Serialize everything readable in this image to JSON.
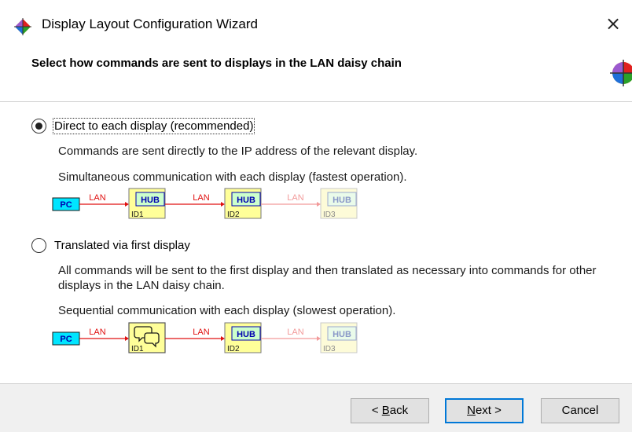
{
  "window": {
    "title": "Display Layout Configuration Wizard",
    "close_glyph": "×"
  },
  "header": {
    "title": "Select how commands are sent to displays in the LAN daisy chain"
  },
  "options": [
    {
      "label": "Direct to each display (recommended)",
      "selected": true,
      "descriptions": [
        "Commands are sent directly to the IP address of the relevant display.",
        "Simultaneous communication with each display (fastest operation)."
      ]
    },
    {
      "label": "Translated via first display",
      "selected": false,
      "descriptions": [
        "All commands will be sent to the first display and then translated as necessary into commands for other displays in the LAN daisy chain.",
        "Sequential communication with each display (slowest operation)."
      ]
    }
  ],
  "diagram": {
    "pc_label": "PC",
    "lan_label": "LAN",
    "hub_label": "HUB",
    "ids": [
      "ID1",
      "ID2",
      "ID3"
    ],
    "colors": {
      "pc": "#00e5ff",
      "display": "#ffff99",
      "hub": "#ccffcc",
      "link": "#e01010",
      "link_faded": "#f29a9a"
    }
  },
  "footer": {
    "back_label": "< Back",
    "back_mnemonic": "B",
    "next_label": "Next >",
    "next_mnemonic": "N",
    "cancel_label": "Cancel"
  },
  "icons": {
    "app": "wizard-app-icon",
    "close": "close-icon",
    "chat": "chat-bubbles-icon"
  }
}
